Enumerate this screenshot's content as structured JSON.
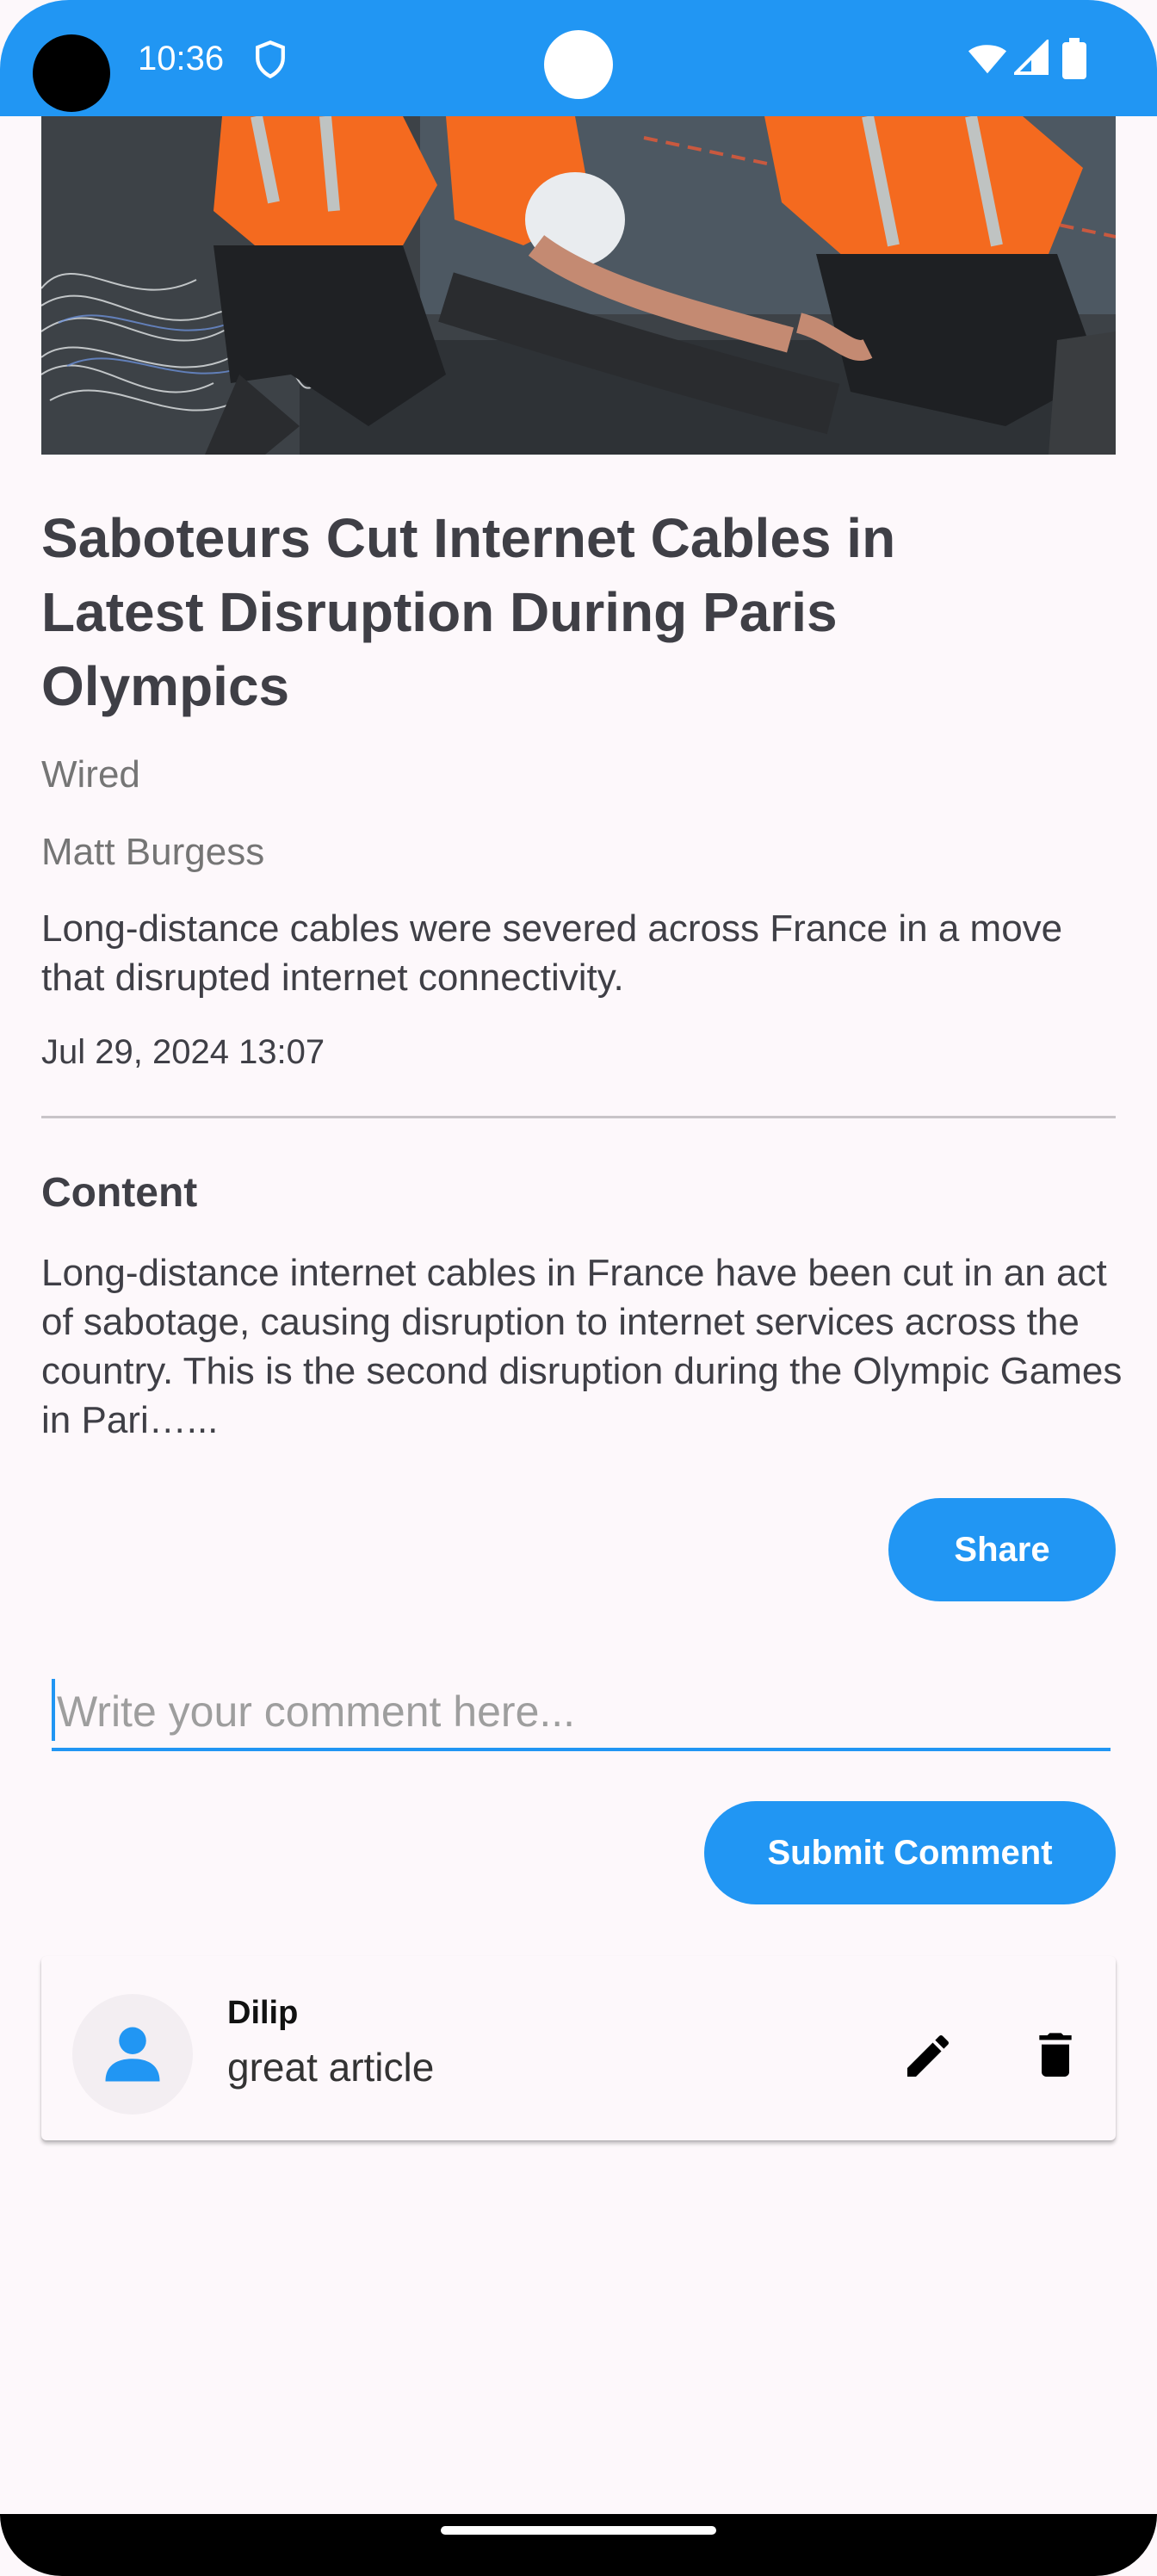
{
  "status_bar": {
    "time": "10:36"
  },
  "article": {
    "title": "Saboteurs Cut Internet Cables in Latest Disruption During Paris Olympics",
    "source": "Wired",
    "author": "Matt Burgess",
    "description": "Long-distance cables were severed across France in a move that disrupted internet connectivity.",
    "date": "Jul 29, 2024 13:07",
    "content_heading": "Content",
    "content": "Long-distance internet cables in France have been cut in an act of sabotage, causing disruption to internet services across the country. This is the second disruption during the Olympic Games in Pari…...",
    "share_label": "Share"
  },
  "comment_form": {
    "placeholder": "Write your comment here...",
    "value": "",
    "submit_label": "Submit Comment"
  },
  "comments": [
    {
      "user": "Dilip",
      "text": "great article"
    }
  ],
  "colors": {
    "primary": "#2196f3",
    "text": "#3f3f46",
    "muted": "#757575",
    "background": "#fdf8fb"
  },
  "icons": {
    "status": [
      "shield-icon",
      "wifi-icon",
      "signal-icon",
      "battery-icon"
    ],
    "comment": [
      "person-icon",
      "edit-icon",
      "delete-icon"
    ]
  }
}
